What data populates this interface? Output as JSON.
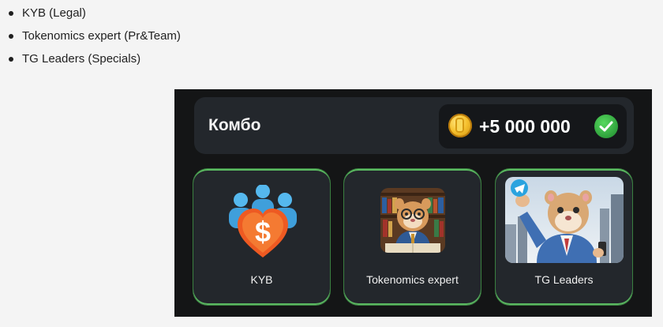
{
  "list": [
    "KYB (Legal)",
    "Tokenomics expert (Pr&Team)",
    "TG Leaders (Specials)"
  ],
  "combo": {
    "title": "Комбо",
    "reward": "+5 000 000",
    "coin_icon": "coin-icon",
    "status_icon": "check-icon"
  },
  "cards": [
    {
      "label": "KYB",
      "icon": "people-dollar-heart-icon"
    },
    {
      "label": "Tokenomics expert",
      "icon": "hamster-scholar-image"
    },
    {
      "label": "TG Leaders",
      "icon": "hamster-businessman-image"
    }
  ],
  "colors": {
    "panel_bg": "#141516",
    "card_bg": "#23272c",
    "card_border": "#5cbb62",
    "accent_blue": "#4fb6f0",
    "accent_orange": "#f0641e",
    "check_green": "#2fa13c"
  }
}
